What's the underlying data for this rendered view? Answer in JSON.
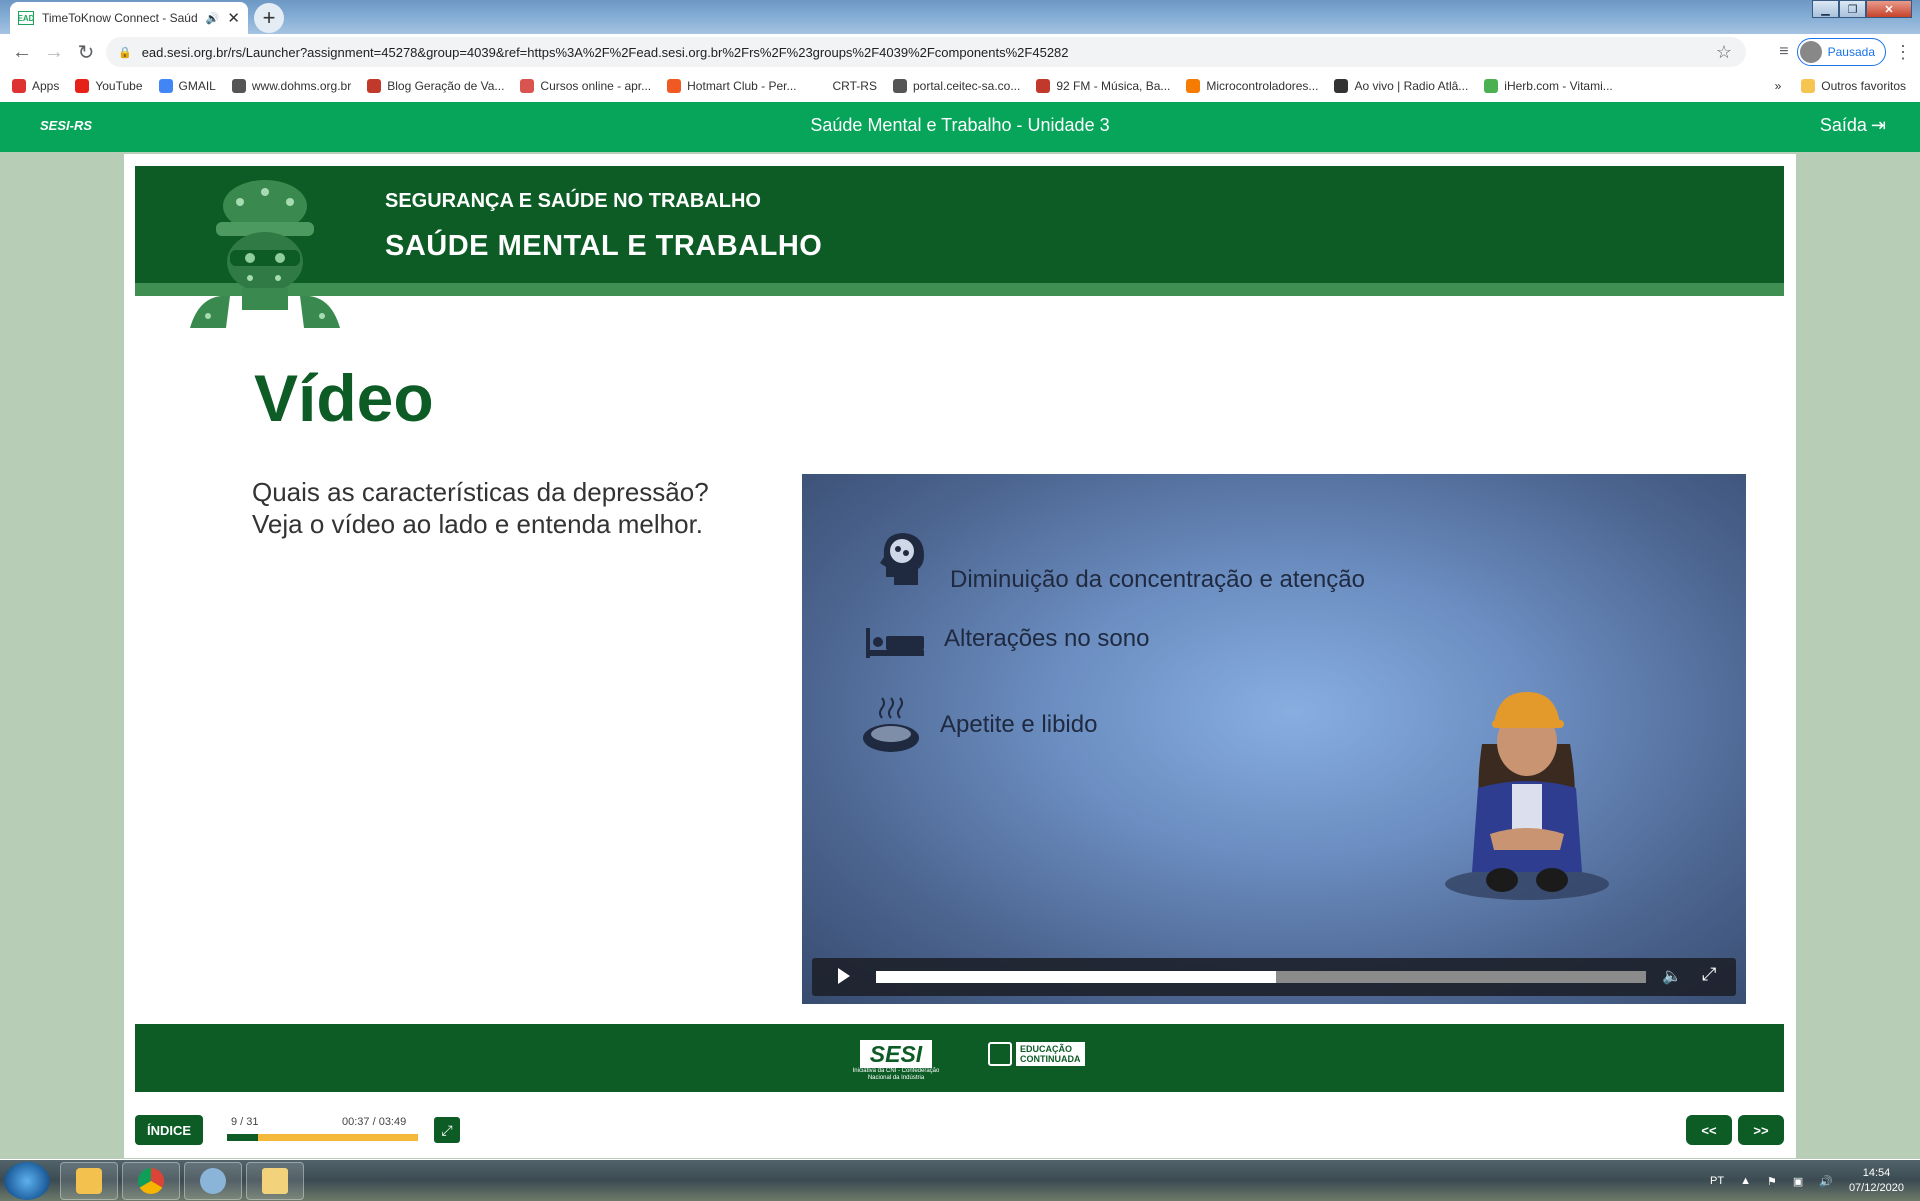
{
  "browser": {
    "tab_title": "TimeToKnow Connect - Saúde",
    "tab_favicon": "EAD",
    "new_tab": "+",
    "url": "ead.sesi.org.br/rs/Launcher?assignment=45278&group=4039&ref=https%3A%2F%2Fead.sesi.org.br%2Frs%2F%23groups%2F4039%2Fcomponents%2F45282",
    "profile_label": "Pausada"
  },
  "bookmarks": [
    {
      "label": "Apps",
      "color": "#d33"
    },
    {
      "label": "YouTube",
      "color": "#e62117"
    },
    {
      "label": "GMAIL",
      "color": "#4285f4"
    },
    {
      "label": "www.dohms.org.br",
      "color": "#555"
    },
    {
      "label": "Blog Geração de Va...",
      "color": "#c0392b"
    },
    {
      "label": "Cursos online - apr...",
      "color": "#d9534f"
    },
    {
      "label": "Hotmart Club - Per...",
      "color": "#f05a22"
    },
    {
      "label": "CRT-RS",
      "color": "#ffffff"
    },
    {
      "label": "portal.ceitec-sa.co...",
      "color": "#555"
    },
    {
      "label": "92 FM - Música, Ba...",
      "color": "#c0392b"
    },
    {
      "label": "Microcontroladores...",
      "color": "#f57c00"
    },
    {
      "label": "Ao vivo | Radio Atlâ...",
      "color": "#333"
    },
    {
      "label": "iHerb.com - Vitami...",
      "color": "#4caf50"
    }
  ],
  "bookmarks_more": "»",
  "bookmarks_other": "Outros favoritos",
  "app": {
    "logo": "SESI-RS",
    "title": "Saúde Mental e Trabalho - Unidade 3",
    "exit_label": "Saída"
  },
  "banner": {
    "subtitle": "SEGURANÇA E SAÚDE NO TRABALHO",
    "title": "SAÚDE MENTAL E TRABALHO"
  },
  "page": {
    "heading": "Vídeo",
    "intro_line1": "Quais as características da depressão?",
    "intro_line2": "Veja o vídeo ao lado e entenda melhor."
  },
  "video": {
    "items": [
      {
        "label": "Diminuição da concentração e atenção",
        "icon": "brain-head-icon"
      },
      {
        "label": "Alterações no sono",
        "icon": "bed-icon"
      },
      {
        "label": "Apetite e libido",
        "icon": "food-plate-icon"
      }
    ],
    "progress": 0.52
  },
  "footer": {
    "sesi_logo": "SESI",
    "sesi_tagline": "Iniciativa da CNI - Confederação Nacional da Indústria",
    "edu_logo_line1": "EDUCAÇÃO",
    "edu_logo_line2": "CONTINUADA"
  },
  "nav": {
    "index_label": "ÍNDICE",
    "page_counter": "9 / 31",
    "time": "00:37 / 03:49",
    "progress": 0.16,
    "prev_label": "<<",
    "next_label": ">>"
  },
  "taskbar": {
    "lang": "PT",
    "time": "14:54",
    "date": "07/12/2020"
  },
  "colors": {
    "brand_green": "#06a55a",
    "dark_green": "#0d5c26",
    "progress_orange": "#f4b93a"
  }
}
